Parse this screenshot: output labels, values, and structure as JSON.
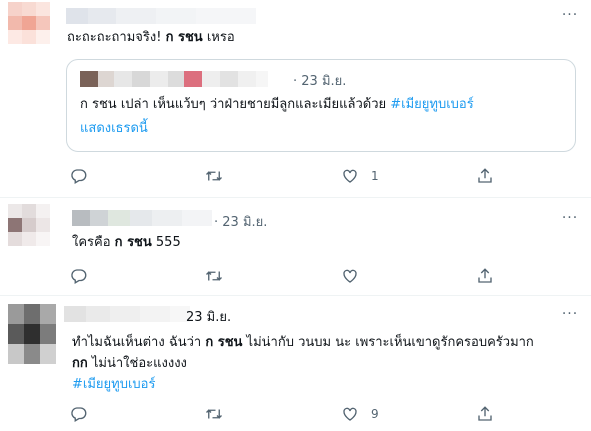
{
  "tweets": [
    {
      "text_prefix": "ถะถะถะถามจริง! ",
      "text_bold": "ก รชน",
      "text_suffix": " เหรอ",
      "quote": {
        "date": "· 23 มิ.ย.",
        "line_prefix": "ก รชน เปล่า เห็นแว้บๆ ว่าฝ่ายชายมีลูกและเมียแล้วด้วย ",
        "hashtag": "#เมียยูทูบเบอร์",
        "show_thread": "แสดงเธรดนี้"
      },
      "likes": "1"
    },
    {
      "date": "· 23 มิ.ย.",
      "text_prefix": "ใครคือ ",
      "text_bold": "ก รชน",
      "text_suffix": " 555"
    },
    {
      "date": "23 มิ.ย.",
      "line1_prefix": "ทำไมฉันเห็นต่าง ฉันว่า ",
      "line1_bold": "ก รชน",
      "line1_suffix": " ไม่น่ากับ วนบม นะ เพราะเห็นเขาดูรักครอบครัวมาก",
      "line2_bold": "กก",
      "line2_suffix": " ไม่น่าใช่อะแงงงง",
      "hashtag": "#เมียยูทูบเบอร์",
      "likes": "9"
    }
  ],
  "colors": {
    "accent": "#1d9bf0",
    "secondary_text": "#536471",
    "border": "#cfd9de"
  },
  "icons": [
    "more-icon",
    "reply-icon",
    "retweet-icon",
    "like-icon",
    "share-icon"
  ]
}
